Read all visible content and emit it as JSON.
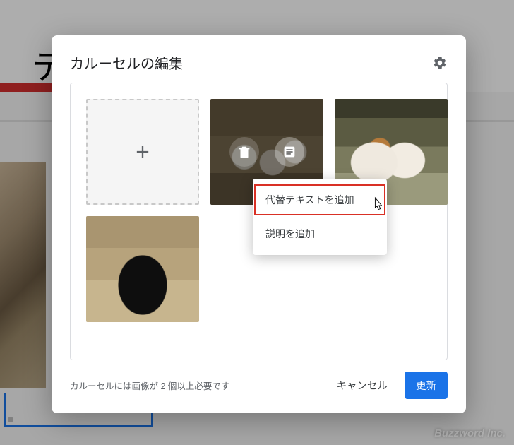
{
  "background": {
    "title_fragment": "テ",
    "watermark": "Buzzword Inc."
  },
  "dialog": {
    "title": "カルーセルの編集",
    "gear_icon": "settings-gear",
    "add_tile_icon": "plus",
    "tiles": [
      {
        "kind": "add"
      },
      {
        "kind": "image",
        "alt": "sheep",
        "selected": true
      },
      {
        "kind": "image",
        "alt": "guinea-pigs",
        "selected": false
      },
      {
        "kind": "image",
        "alt": "black-goat",
        "selected": false
      }
    ],
    "tile_actions": {
      "delete_icon": "trash",
      "text_icon": "text-lines"
    },
    "popover": {
      "items": [
        {
          "label": "代替テキストを追加",
          "highlighted": true
        },
        {
          "label": "説明を追加",
          "highlighted": false
        }
      ]
    },
    "footer": {
      "note": "カルーセルには画像が 2 個以上必要です",
      "cancel": "キャンセル",
      "update": "更新"
    }
  }
}
